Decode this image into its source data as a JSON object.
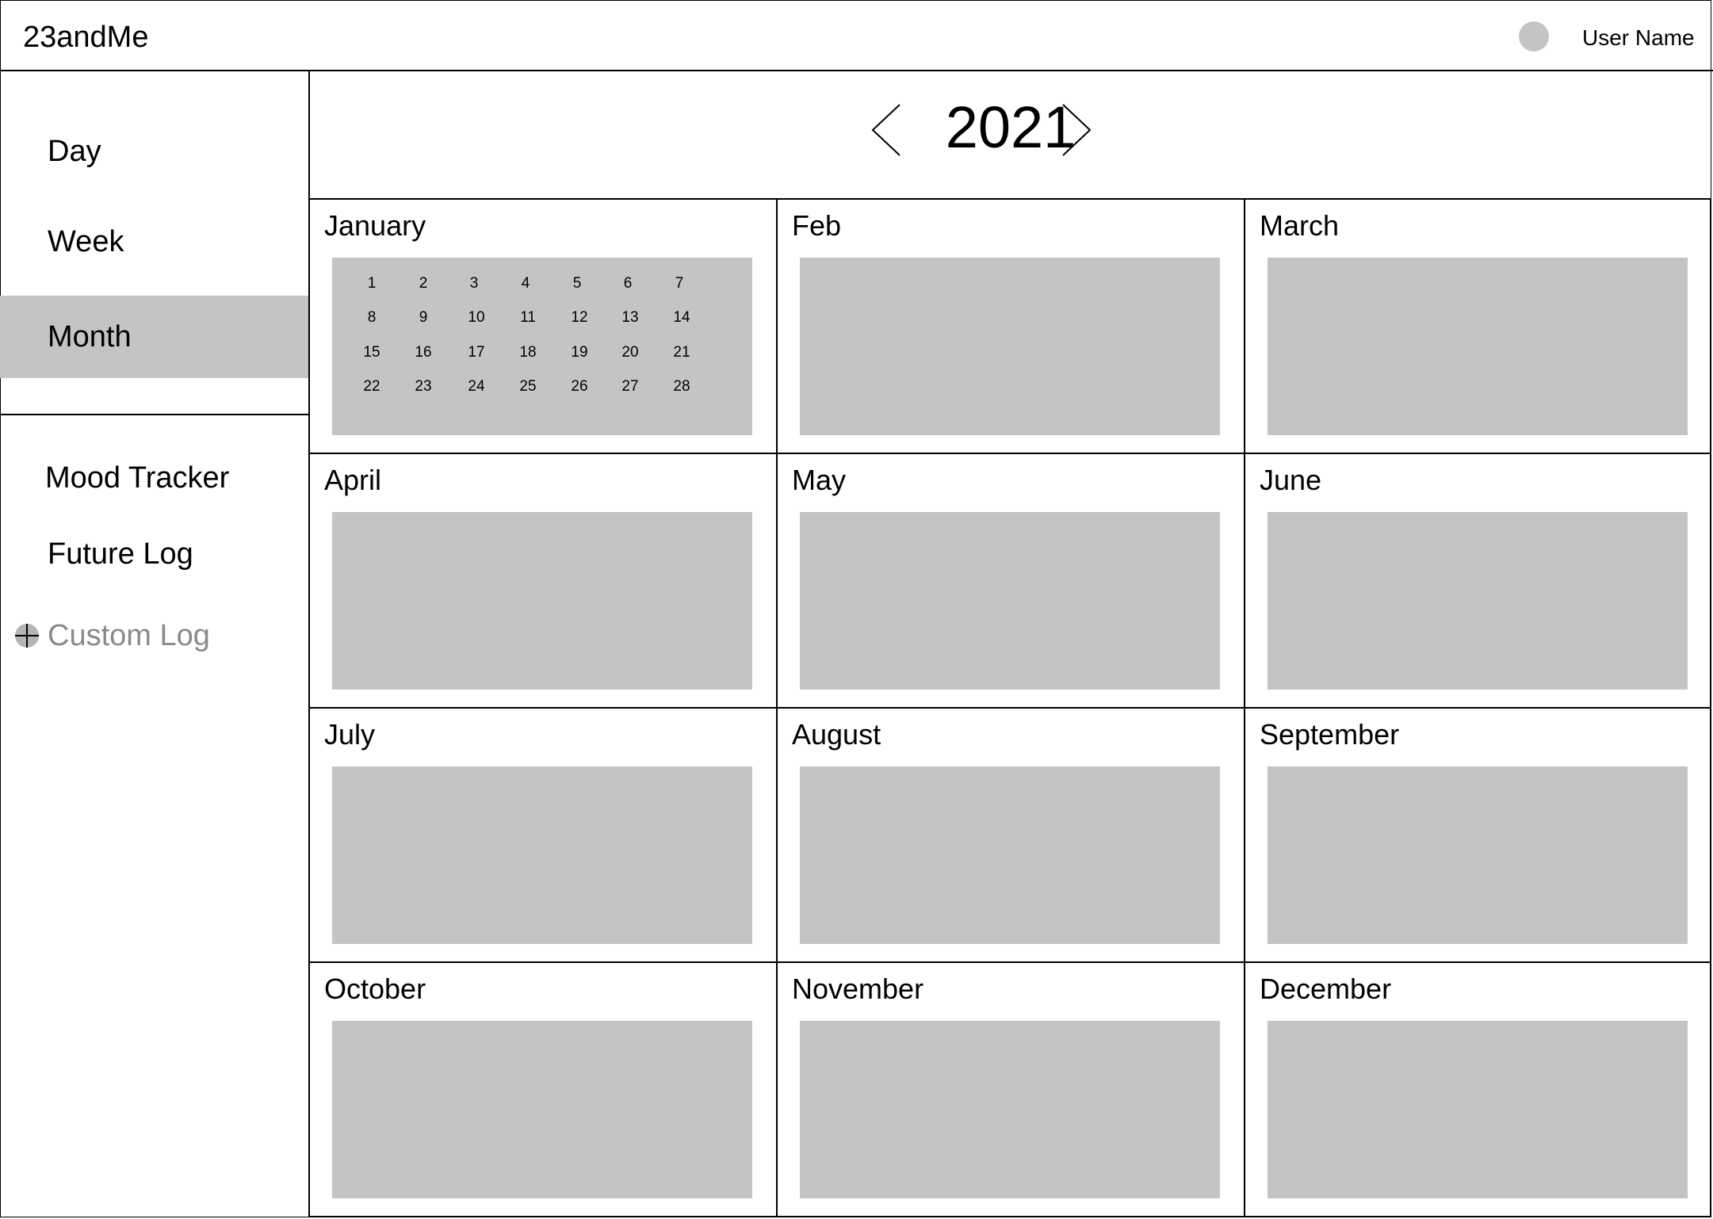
{
  "header": {
    "logo": "23andMe",
    "user_name": "User Name"
  },
  "sidebar": {
    "views": [
      {
        "label": "Day",
        "active": false
      },
      {
        "label": "Week",
        "active": false
      },
      {
        "label": "Month",
        "active": true
      }
    ],
    "tools": {
      "mood_tracker": "Mood Tracker",
      "future_log": "Future Log",
      "custom_log": "Custom Log"
    }
  },
  "year_nav": {
    "year": "2021"
  },
  "months": [
    {
      "name": "January",
      "days": [
        "1",
        "2",
        "3",
        "4",
        "5",
        "6",
        "7",
        "8",
        "9",
        "10",
        "11",
        "12",
        "13",
        "14",
        "15",
        "16",
        "17",
        "18",
        "19",
        "20",
        "21",
        "22",
        "23",
        "24",
        "25",
        "26",
        "27",
        "28"
      ]
    },
    {
      "name": "Feb",
      "days": []
    },
    {
      "name": "March",
      "days": []
    },
    {
      "name": "April",
      "days": []
    },
    {
      "name": "May",
      "days": []
    },
    {
      "name": "June",
      "days": []
    },
    {
      "name": "July",
      "days": []
    },
    {
      "name": "August",
      "days": []
    },
    {
      "name": "September",
      "days": []
    },
    {
      "name": "October",
      "days": []
    },
    {
      "name": "November",
      "days": []
    },
    {
      "name": "December",
      "days": []
    }
  ],
  "colors": {
    "placeholder_gray": "#c4c4c4",
    "muted_text": "#8a8a8a"
  }
}
